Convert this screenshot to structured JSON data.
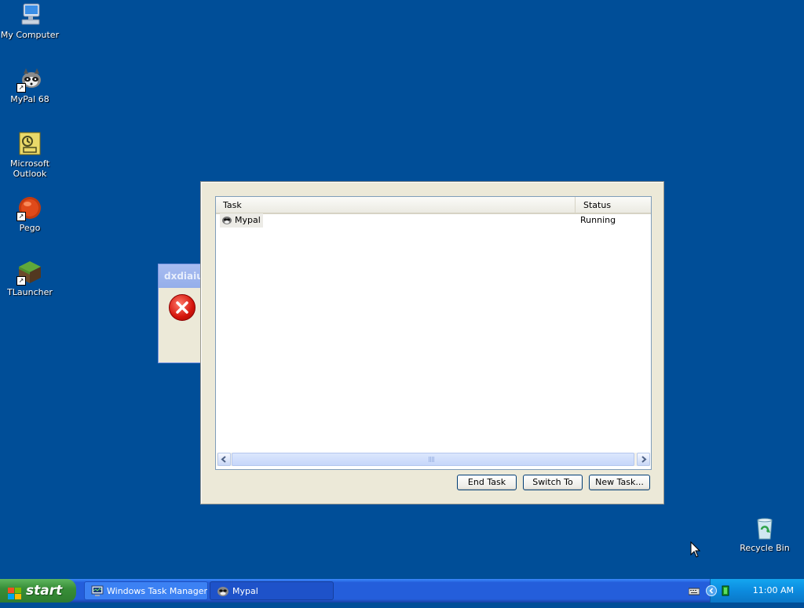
{
  "desktop": {
    "icons": [
      {
        "label": "My Computer",
        "icon": "my-computer-icon"
      },
      {
        "label": "MyPal 68",
        "icon": "raccoon-icon"
      },
      {
        "label": "Microsoft Outlook",
        "icon": "outlook-icon"
      },
      {
        "label": "Pego",
        "icon": "pego-icon"
      },
      {
        "label": "TLauncher",
        "icon": "grass-block-icon"
      },
      {
        "label": "Recycle Bin",
        "icon": "recycle-bin-icon"
      }
    ],
    "background_color": "#004e98"
  },
  "error_dialog": {
    "title": "dxdiaiu",
    "icon": "error-icon"
  },
  "task_manager": {
    "columns": {
      "task": "Task",
      "status": "Status"
    },
    "tasks": [
      {
        "name": "Mypal",
        "status": "Running"
      }
    ],
    "buttons": {
      "end_task": "End Task",
      "switch_to": "Switch To",
      "new_task": "New Task..."
    }
  },
  "taskbar": {
    "start_label": "start",
    "items": [
      {
        "label": "Windows Task Manager",
        "icon": "task-manager-icon"
      },
      {
        "label": "Mypal",
        "icon": "raccoon-icon"
      }
    ],
    "clock": "11:00 AM"
  }
}
